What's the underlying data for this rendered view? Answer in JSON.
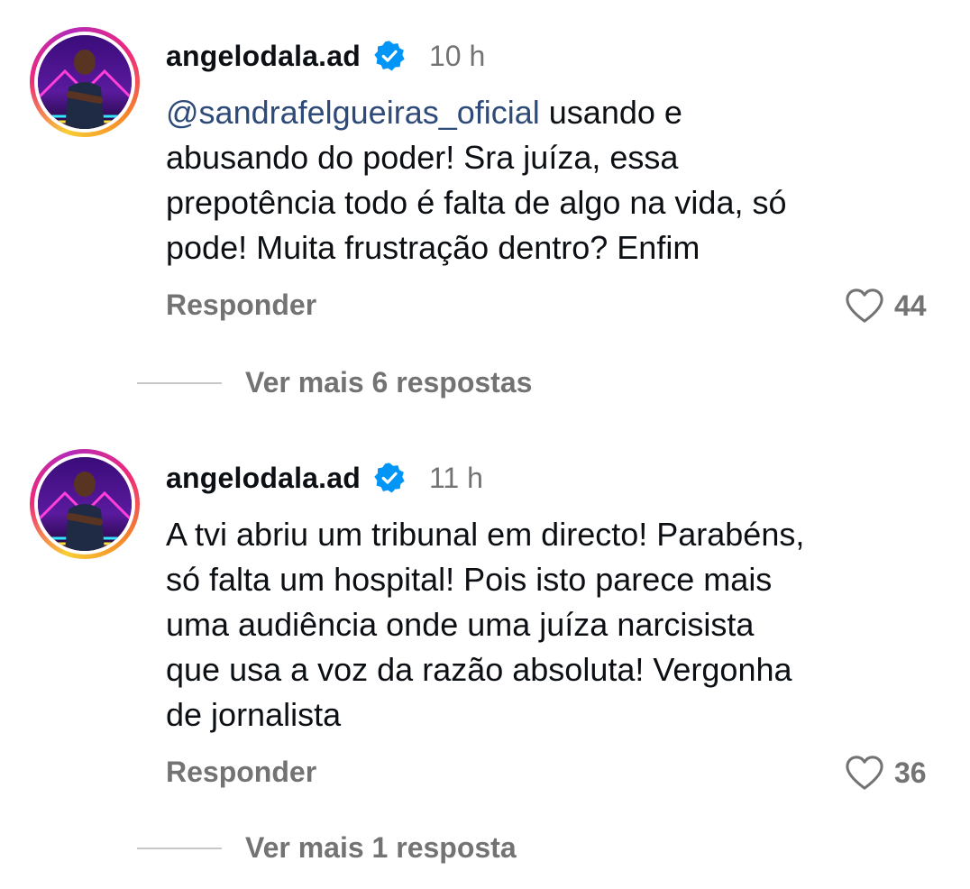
{
  "comments": [
    {
      "username": "angelodala.ad",
      "verified": true,
      "time": "10 h",
      "mention": "@sandrafelgueiras_oficial",
      "text_lines": [
        " usando e",
        "abusando do poder! Sra juíza, essa",
        "prepotência todo é falta de algo na vida, só",
        "pode! Muita frustração dentro? Enfim"
      ],
      "reply_label": "Responder",
      "likes": "44",
      "more_replies": "Ver mais 6 respostas"
    },
    {
      "username": "angelodala.ad",
      "verified": true,
      "time": "11 h",
      "text_lines": [
        "A tvi abriu um tribunal em directo! Parabéns,",
        "só falta um hospital! Pois isto parece mais",
        "uma audiência onde uma juíza narcisista",
        "que usa a voz da razão absoluta! Vergonha",
        "de jornalista"
      ],
      "reply_label": "Responder",
      "likes": "36",
      "more_replies": "Ver mais 1 resposta"
    }
  ],
  "icons": {
    "verified": "verified-badge-icon",
    "like": "heart-outline-icon"
  },
  "colors": {
    "text": "#0c1014",
    "muted": "#737373",
    "mention": "#2d4a78",
    "verified": "#0095f6",
    "divider": "#c7c7c7"
  }
}
